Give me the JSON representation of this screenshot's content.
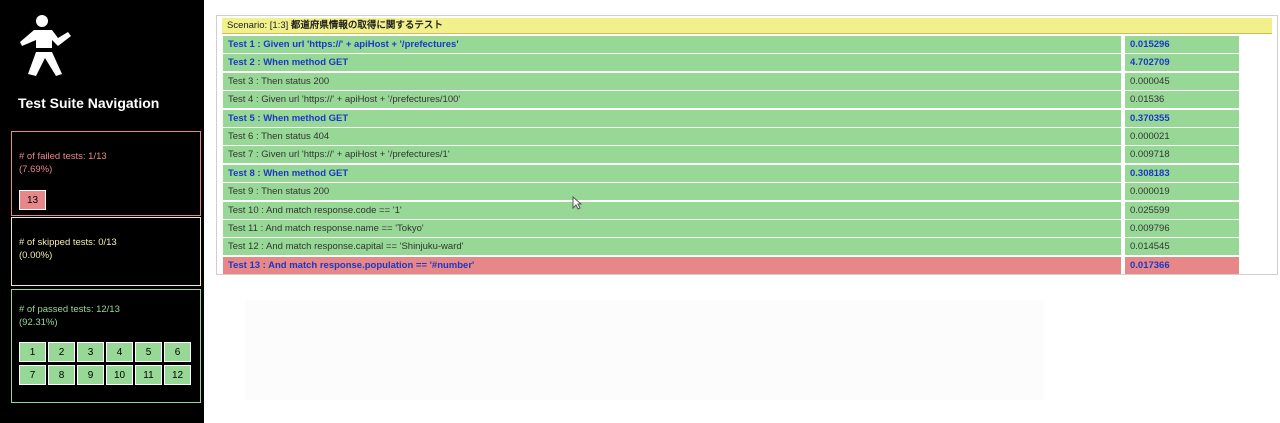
{
  "sidebar": {
    "title": "Test Suite Navigation",
    "failed": {
      "label": "# of failed tests: 1/13",
      "pct": "(7.69%)",
      "tests": [
        "13"
      ]
    },
    "skipped": {
      "label": "# of skipped tests: 0/13",
      "pct": "(0.00%)"
    },
    "passed": {
      "label": "# of passed tests: 12/13",
      "pct": "(92.31%)",
      "tests": [
        "1",
        "2",
        "3",
        "4",
        "5",
        "6",
        "7",
        "8",
        "9",
        "10",
        "11",
        "12"
      ]
    }
  },
  "scenario": {
    "prefix": "Scenario: [1:3]",
    "name": "都道府県情報の取得に関するテスト"
  },
  "tests": [
    {
      "name": "Test 1 : Given url 'https://' + apiHost + '/prefectures'",
      "time": "0.015296",
      "status": "pass",
      "bold": true
    },
    {
      "name": "Test 2 : When method GET",
      "time": "4.702709",
      "status": "pass",
      "bold": true
    },
    {
      "name": "Test 3 : Then status 200",
      "time": "0.000045",
      "status": "pass",
      "bold": false
    },
    {
      "name": "Test 4 : Given url 'https://' + apiHost + '/prefectures/100'",
      "time": "0.01536",
      "status": "pass",
      "bold": false
    },
    {
      "name": "Test 5 : When method GET",
      "time": "0.370355",
      "status": "pass",
      "bold": true
    },
    {
      "name": "Test 6 : Then status 404",
      "time": "0.000021",
      "status": "pass",
      "bold": false
    },
    {
      "name": "Test 7 : Given url 'https://' + apiHost + '/prefectures/1'",
      "time": "0.009718",
      "status": "pass",
      "bold": false
    },
    {
      "name": "Test 8 : When method GET",
      "time": "0.308183",
      "status": "pass",
      "bold": true
    },
    {
      "name": "Test 9 : Then status 200",
      "time": "0.000019",
      "status": "pass",
      "bold": false
    },
    {
      "name": "Test 10 : And match response.code == '1'",
      "time": "0.025599",
      "status": "pass",
      "bold": false
    },
    {
      "name": "Test 11 : And match response.name == 'Tokyo'",
      "time": "0.009796",
      "status": "pass",
      "bold": false
    },
    {
      "name": "Test 12 : And match response.capital == 'Shinjuku-ward'",
      "time": "0.014545",
      "status": "pass",
      "bold": false
    },
    {
      "name": "Test 13 : And match response.population == '#number'",
      "time": "0.017366",
      "status": "fail",
      "bold": true
    }
  ],
  "colors": {
    "pass": "#97d897",
    "fail": "#e88787",
    "skip": "#f4ecb0",
    "scenario": "#f2f08a",
    "link": "#1a38c8"
  },
  "icons": {
    "logo": "karate-figure-icon",
    "cursor": "mouse-pointer-icon"
  }
}
